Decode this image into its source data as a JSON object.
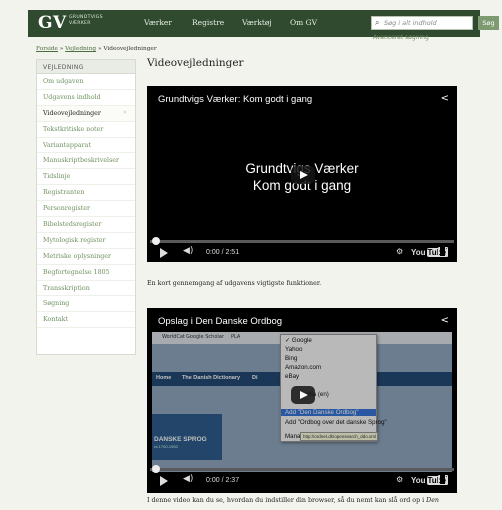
{
  "header": {
    "logo": "GV",
    "logo_sub_1": "GRUNDTVIGS",
    "logo_sub_2": "VÆRKER",
    "nav": [
      "Værker",
      "Registre",
      "Værktøj",
      "Om GV"
    ],
    "search_placeholder": "Søg i alt indhold",
    "search_button": "Søg",
    "advanced_search": "Avanceret søgning"
  },
  "breadcrumb": {
    "items": [
      "Forside",
      "Vejledning"
    ],
    "separator": "»",
    "current": "Videovejledninger"
  },
  "sidebar": {
    "heading": "VEJLEDNING",
    "items": [
      "Om udgaven",
      "Udgavens indhold",
      "Videovejledninger",
      "Tekstkritiske noter",
      "Variantapparat",
      "Manuskriptbeskrivelser",
      "Tidslinje",
      "Registranten",
      "Personregister",
      "Bibelstedsregister",
      "Mytologisk register",
      "Metriske oplysninger",
      "Begfortegnelse 1805",
      "Transskription",
      "Søgning",
      "Kontakt"
    ],
    "active_index": 2,
    "active_arrow": "›"
  },
  "main": {
    "title": "Videovejledninger",
    "video1": {
      "title": "Grundtvigs Værker: Kom godt i gang",
      "center_line1": "Grundtvigs Værker",
      "center_line2": "Kom godt i gang",
      "time": "0:00 / 2:51",
      "caption": "En kort gennemgang af udgavens vigtigste funktioner."
    },
    "video2": {
      "title": "Opslag i Den Danske Ordbog",
      "time": "0:00 / 2:37",
      "bookmarks": [
        "WorldCat",
        "Google Scholar",
        "PLA"
      ],
      "menu": [
        "✓ Google",
        "Yahoo",
        "Bing",
        "Amazon.com",
        "eBay",
        "pedia (en)",
        "Add \"Den Danske Ordbog\"",
        "Add \"Ordbog over det danske Sprog\"",
        "Manage Search Engines..."
      ],
      "menu_selected": 6,
      "tooltip": "http://ordnet.dk/opensearch_ddo.xml",
      "site_nav": [
        "Home",
        "The Danish Dictionary",
        "Di"
      ],
      "site_box_title": "DANSKE SPROG",
      "site_box_sub": "ra 1700-1950",
      "caption_prefix": "I denne video kan du se, hvordan du indstiller din browser, så du nemt kan slå ord op i",
      "caption_italic": "Den"
    },
    "youtube_label": "You",
    "youtube_tube": "Tube"
  },
  "icons": {
    "share": "share-icon",
    "volume": "volume-icon",
    "settings": "gear-icon",
    "search": "search-icon"
  },
  "colors": {
    "header_bg": "#2f4a2e",
    "link": "#6f9160",
    "search_button_bg": "#7d9a70"
  }
}
